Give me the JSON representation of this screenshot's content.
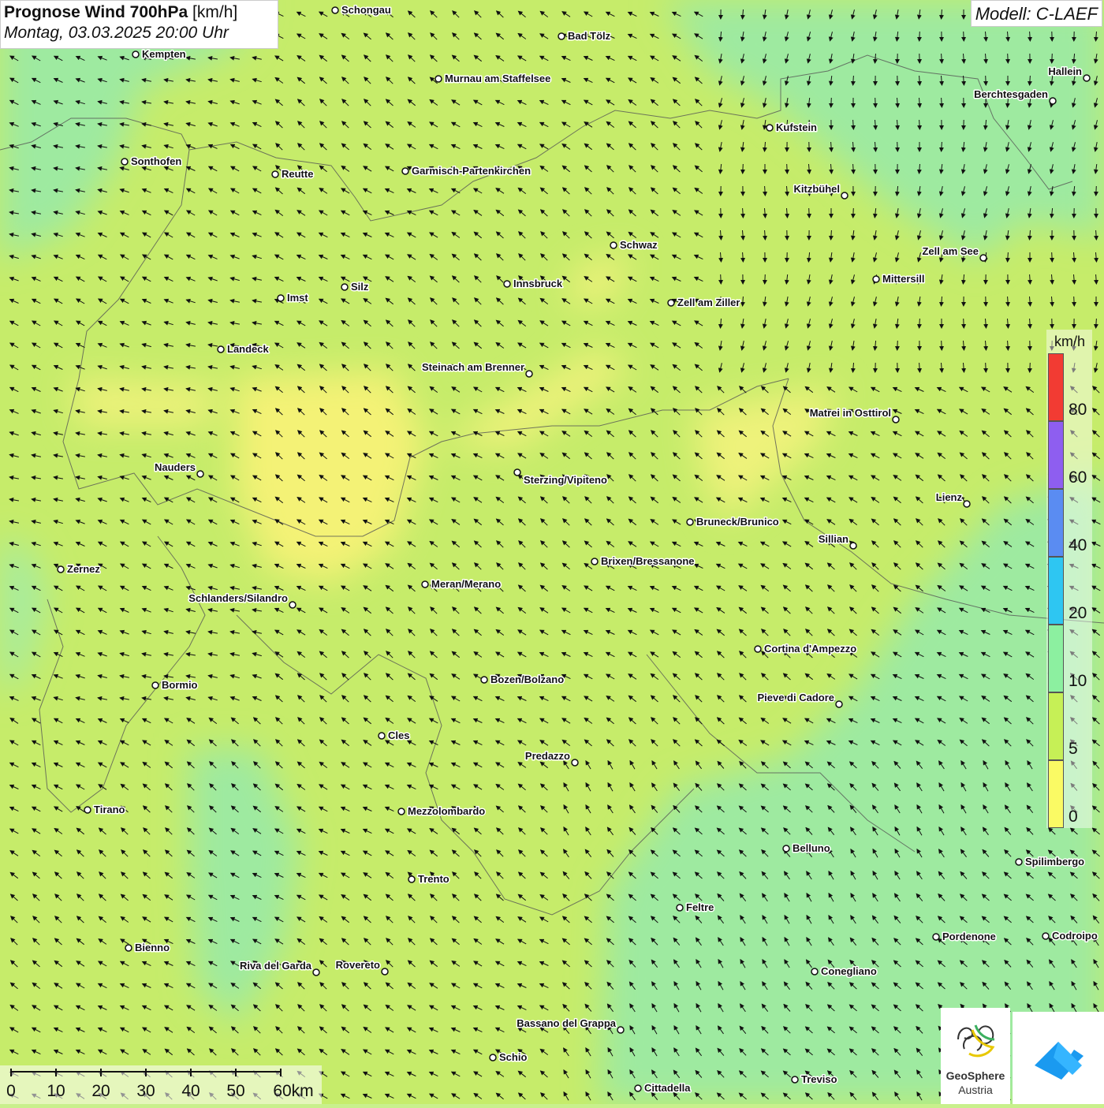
{
  "header": {
    "title_bold": "Prognose Wind 700hPa",
    "title_unit": "[km/h]",
    "datetime": "Montag, 03.03.2025 20:00 Uhr",
    "model": "Modell: C-LAEF"
  },
  "legend": {
    "unit": "km/h",
    "labels": [
      "80",
      "60",
      "40",
      "20",
      "10",
      "5",
      "0"
    ],
    "colors": [
      "#f23b33",
      "#8e5ef0",
      "#5a8cf2",
      "#2ec6f2",
      "#8cf0a0",
      "#c6f056",
      "#fafa64"
    ]
  },
  "scalebar": {
    "ticks": [
      "0",
      "10",
      "20",
      "30",
      "40",
      "50",
      "60km"
    ]
  },
  "cities": [
    {
      "name": "Schongau"
    },
    {
      "name": "Bad Tölz"
    },
    {
      "name": "Kempten"
    },
    {
      "name": "Murnau am Staffelsee"
    },
    {
      "name": "Hallein"
    },
    {
      "name": "Berchtesgaden"
    },
    {
      "name": "Kufstein"
    },
    {
      "name": "Sonthofen"
    },
    {
      "name": "Reutte"
    },
    {
      "name": "Garmisch-Partenkirchen"
    },
    {
      "name": "Kitzbühel"
    },
    {
      "name": "Schwaz"
    },
    {
      "name": "Zell am See"
    },
    {
      "name": "Mittersill"
    },
    {
      "name": "Silz"
    },
    {
      "name": "Innsbruck"
    },
    {
      "name": "Imst"
    },
    {
      "name": "Zell am Ziller"
    },
    {
      "name": "Landeck"
    },
    {
      "name": "Steinach am Brenner"
    },
    {
      "name": "Matrei in Osttirol"
    },
    {
      "name": "Nauders"
    },
    {
      "name": "Sterzing/Vipiteno"
    },
    {
      "name": "Lienz"
    },
    {
      "name": "Bruneck/Brunico"
    },
    {
      "name": "Sillian"
    },
    {
      "name": "Zernez"
    },
    {
      "name": "Brixen/Bressanone"
    },
    {
      "name": "Meran/Merano"
    },
    {
      "name": "Schlanders/Silandro"
    },
    {
      "name": "Cortina d'Ampezzo"
    },
    {
      "name": "Bormio"
    },
    {
      "name": "Bozen/Bolzano"
    },
    {
      "name": "Pieve di Cadore"
    },
    {
      "name": "Cles"
    },
    {
      "name": "Predazzo"
    },
    {
      "name": "Tirano"
    },
    {
      "name": "Mezzolombardo"
    },
    {
      "name": "Belluno"
    },
    {
      "name": "Spilimbergo"
    },
    {
      "name": "Trento"
    },
    {
      "name": "Feltre"
    },
    {
      "name": "Pordenone"
    },
    {
      "name": "Codroipo"
    },
    {
      "name": "Bienno"
    },
    {
      "name": "Riva del Garda"
    },
    {
      "name": "Rovereto"
    },
    {
      "name": "Conegliano"
    },
    {
      "name": "Bassano del Grappa"
    },
    {
      "name": "Schio"
    },
    {
      "name": "Treviso"
    },
    {
      "name": "Cittadella"
    }
  ],
  "logos": {
    "geosphere_line1": "GeoSphere",
    "geosphere_line2": "Austria"
  }
}
